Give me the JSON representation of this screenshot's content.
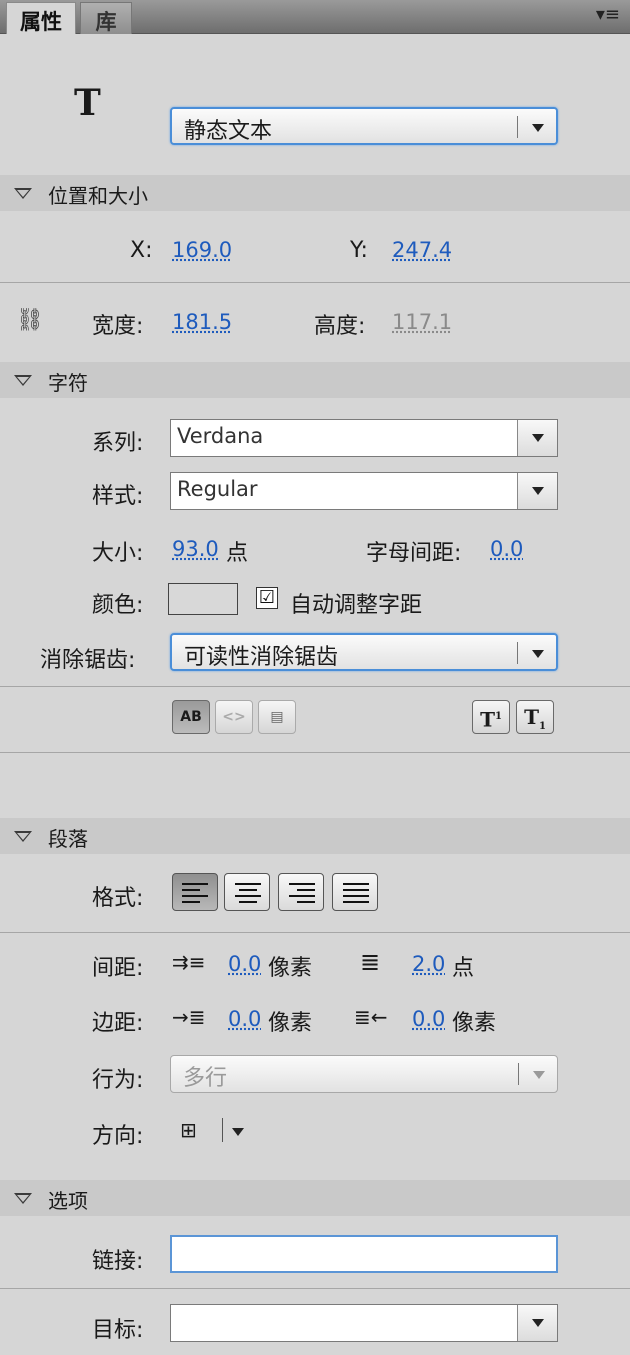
{
  "tabs": [
    {
      "label": "属性"
    },
    {
      "label": "库"
    }
  ],
  "text_tool_glyph": "T",
  "text_type": "静态文本",
  "sections": {
    "position_size": "位置和大小",
    "character": "字符",
    "paragraph": "段落",
    "options": "选项"
  },
  "position": {
    "x_label": "X:",
    "x_value": "169.0",
    "y_label": "Y:",
    "y_value": "247.4",
    "width_label": "宽度:",
    "width_value": "181.5",
    "height_label": "高度:",
    "height_value": "117.1"
  },
  "character": {
    "family_label": "系列:",
    "family_value": "Verdana",
    "style_label": "样式:",
    "style_value": "Regular",
    "size_label": "大小:",
    "size_value": "93.0",
    "size_unit": "点",
    "spacing_label": "字母间距:",
    "spacing_value": "0.0",
    "color_label": "颜色:",
    "autokern_checkmark": "☑",
    "autokern_label": "自动调整字距",
    "antialias_label": "消除锯齿:",
    "antialias_value": "可读性消除锯齿",
    "btn_selectable": "AB",
    "btn_html": "<>",
    "btn_border": "▤",
    "btn_superscript": "T",
    "btn_superscript_mark": "1",
    "btn_subscript": "T",
    "btn_subscript_mark": "1"
  },
  "paragraph": {
    "format_label": "格式:",
    "spacing_label": "间距:",
    "indent_value": "0.0",
    "indent_unit": "像素",
    "line_spacing_value": "2.0",
    "line_spacing_unit": "点",
    "margin_label": "边距:",
    "left_margin_value": "0.0",
    "left_margin_unit": "像素",
    "right_margin_value": "0.0",
    "right_margin_unit": "像素",
    "behavior_label": "行为:",
    "behavior_value": "多行",
    "direction_label": "方向:"
  },
  "options": {
    "link_label": "链接:",
    "link_value": "",
    "target_label": "目标:",
    "target_value": ""
  },
  "icons": {
    "menu": "▾≡",
    "indent": "⇉≡",
    "line_spacing": "≣",
    "left_margin": "→≣",
    "right_margin": "≣←",
    "direction": "⊞",
    "link_chain": "⛓"
  }
}
